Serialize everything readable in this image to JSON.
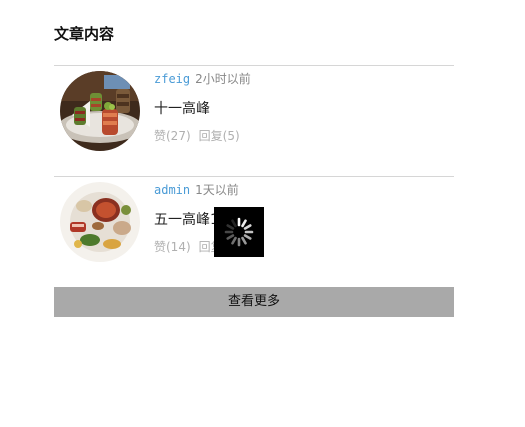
{
  "section": {
    "title": "文章内容"
  },
  "articles": [
    {
      "author": "zfeig",
      "time": "2小时以前",
      "title": "十一高峰",
      "likes": "赞(27)",
      "replies": "回复(5)"
    },
    {
      "author": "admin",
      "time": "1天以前",
      "title": "五一高峰1",
      "likes": "赞(14)",
      "replies": "回复"
    }
  ],
  "load_more": {
    "label": "查看更多"
  },
  "colors": {
    "author_link": "#4a9bd6",
    "load_more_bg": "#a9a9a9",
    "muted_text": "#b0b0b0",
    "spinner_bg": "#000000"
  },
  "icons": {
    "loading": "loading-spinner-icon"
  }
}
